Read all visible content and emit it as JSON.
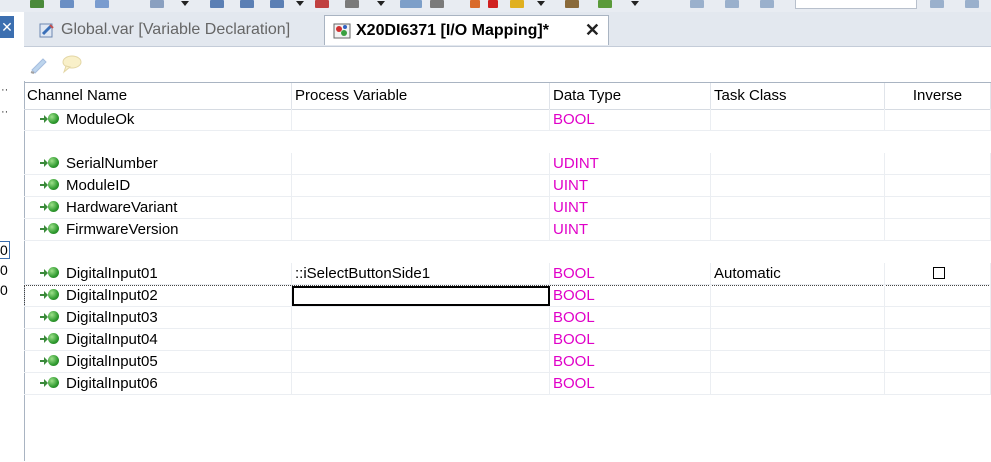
{
  "left_panel": {
    "close_glyph": "✕",
    "dots": [
      "··",
      "··"
    ],
    "numbers": [
      "0",
      "0",
      "0"
    ]
  },
  "tabs": [
    {
      "label": "Global.var [Variable Declaration]",
      "active": false
    },
    {
      "label": "X20DI6371 [I/O Mapping]*",
      "active": true,
      "close_glyph": "✕"
    }
  ],
  "grid": {
    "columns": [
      "Channel Name",
      "Process Variable",
      "Data Type",
      "Task Class",
      "Inverse"
    ],
    "rows": [
      {
        "channel": "ModuleOk",
        "process_variable": "",
        "data_type": "BOOL",
        "task_class": "",
        "inverse": false,
        "has_checkbox": false
      },
      null,
      {
        "channel": "SerialNumber",
        "process_variable": "",
        "data_type": "UDINT",
        "task_class": "",
        "inverse": false,
        "has_checkbox": false
      },
      {
        "channel": "ModuleID",
        "process_variable": "",
        "data_type": "UINT",
        "task_class": "",
        "inverse": false,
        "has_checkbox": false
      },
      {
        "channel": "HardwareVariant",
        "process_variable": "",
        "data_type": "UINT",
        "task_class": "",
        "inverse": false,
        "has_checkbox": false
      },
      {
        "channel": "FirmwareVersion",
        "process_variable": "",
        "data_type": "UINT",
        "task_class": "",
        "inverse": false,
        "has_checkbox": false
      },
      null,
      {
        "channel": "DigitalInput01",
        "process_variable": "::iSelectButtonSide1",
        "data_type": "BOOL",
        "task_class": "Automatic",
        "inverse": false,
        "has_checkbox": true
      },
      {
        "channel": "DigitalInput02",
        "process_variable": "",
        "data_type": "BOOL",
        "task_class": "",
        "inverse": false,
        "has_checkbox": false,
        "editing": true
      },
      {
        "channel": "DigitalInput03",
        "process_variable": "",
        "data_type": "BOOL",
        "task_class": "",
        "inverse": false,
        "has_checkbox": false
      },
      {
        "channel": "DigitalInput04",
        "process_variable": "",
        "data_type": "BOOL",
        "task_class": "",
        "inverse": false,
        "has_checkbox": false
      },
      {
        "channel": "DigitalInput05",
        "process_variable": "",
        "data_type": "BOOL",
        "task_class": "",
        "inverse": false,
        "has_checkbox": false
      },
      {
        "channel": "DigitalInput06",
        "process_variable": "",
        "data_type": "BOOL",
        "task_class": "",
        "inverse": false,
        "has_checkbox": false
      }
    ]
  },
  "colors": {
    "data_type_text": "#e000c8",
    "channel_pin": "#2f9a2f",
    "active_tab_border": "#a9b4c2"
  },
  "icons": [
    "variable-file-icon",
    "io-mapping-icon",
    "close-icon",
    "channel-pin-icon",
    "toolbar-pencil-icon",
    "toolbar-comment-icon"
  ]
}
